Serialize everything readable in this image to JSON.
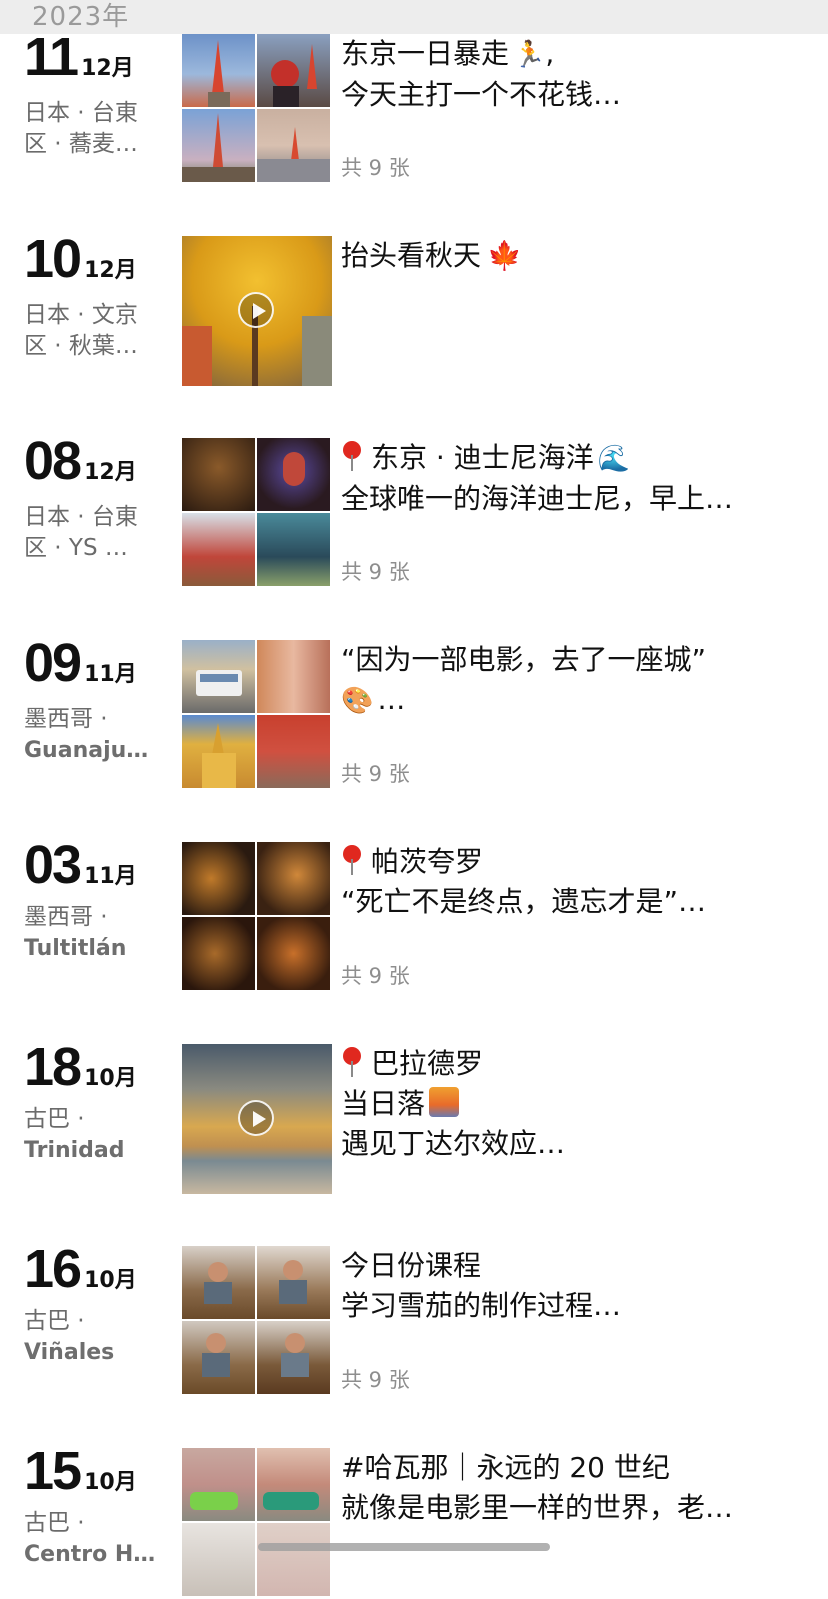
{
  "header": {
    "year": "2023年"
  },
  "posts": [
    {
      "day": "11",
      "month": "12月",
      "loc1": "日本 · 台東",
      "loc2": "区 · 蕎麦…",
      "text1": "东京一日暴走",
      "emoji1": "runner",
      "text1_tail": ",",
      "text2": "今天主打一个不花钱…",
      "text3": "",
      "count": "共 9 张",
      "media": "grid",
      "palette": [
        "#5b7fb5",
        "#c95c3a",
        "#7aa0d0",
        "#b7b0a8"
      ]
    },
    {
      "day": "10",
      "month": "12月",
      "loc1": "日本 · 文京",
      "loc2": "区 · 秋葉…",
      "text1": "抬头看秋天",
      "emoji1": "maple-leaf",
      "text1_tail": "",
      "text2": "",
      "text3": "",
      "count": "",
      "media": "video",
      "palette": [
        "#e0a526",
        "#b87a1d"
      ]
    },
    {
      "day": "08",
      "month": "12月",
      "loc1": "日本 · 台東",
      "loc2": "区 · YS …",
      "text1": "东京 · 迪士尼海洋",
      "emoji1": "wave",
      "text1_tail": "",
      "text2": "全球唯一的海洋迪士尼，早上…",
      "text3": "",
      "count": "共 9 张",
      "media": "grid",
      "pin": true,
      "palette": [
        "#3a2a1c",
        "#5a3a5a",
        "#c0463a",
        "#4a6a7a"
      ]
    },
    {
      "day": "09",
      "month": "11月",
      "loc1": "墨西哥 ·",
      "loc2": "Guanaju…",
      "text1": "“因为一部电影，去了一座城”",
      "emoji1": "",
      "text1_tail": "",
      "text2": "…",
      "text2_emoji": "palette",
      "text3": "",
      "count": "共 9 张",
      "media": "grid",
      "palette": [
        "#8a9ab0",
        "#c07a5a",
        "#d4a23a",
        "#b8402e"
      ]
    },
    {
      "day": "03",
      "month": "11月",
      "loc1": "墨西哥 ·",
      "loc2": "Tultitlán",
      "text1": "帕茨夸罗",
      "emoji1": "",
      "text1_tail": "",
      "text2": "“死亡不是终点，遗忘才是”…",
      "text3": "",
      "count": "共 9 张",
      "media": "grid",
      "pin": true,
      "palette": [
        "#3a2212",
        "#4a2a14",
        "#2e1a10",
        "#5a3416"
      ]
    },
    {
      "day": "18",
      "month": "10月",
      "loc1": "古巴 ·",
      "loc2": "Trinidad",
      "text1": "巴拉德罗",
      "emoji1": "",
      "text1_tail": "",
      "text2": "当日落",
      "text2_emoji": "sunset",
      "text3": "遇见丁达尔效应…",
      "count": "",
      "media": "video",
      "pin": true,
      "palette": [
        "#5a6a7a",
        "#c09a4a"
      ]
    },
    {
      "day": "16",
      "month": "10月",
      "loc1": "古巴 ·",
      "loc2": "Viñales",
      "text1": "今日份课程",
      "emoji1": "",
      "text1_tail": "",
      "text2": "学习雪茄的制作过程…",
      "text3": "",
      "count": "共 9 张",
      "media": "grid",
      "palette": [
        "#8a6a4a",
        "#9a7a5a",
        "#8a6a48",
        "#7a5a3a"
      ]
    },
    {
      "day": "15",
      "month": "10月",
      "loc1": "古巴 ·",
      "loc2": "Centro H…",
      "text1": "#哈瓦那｜永远的 20 世纪",
      "emoji1": "",
      "text1_tail": "",
      "text2": "就像是电影里一样的世界，老…",
      "text3": "",
      "count": "",
      "media": "grid",
      "palette": [
        "#c0908a",
        "#c48a7a",
        "#d8d0c8",
        "#d2b6b0"
      ]
    }
  ]
}
